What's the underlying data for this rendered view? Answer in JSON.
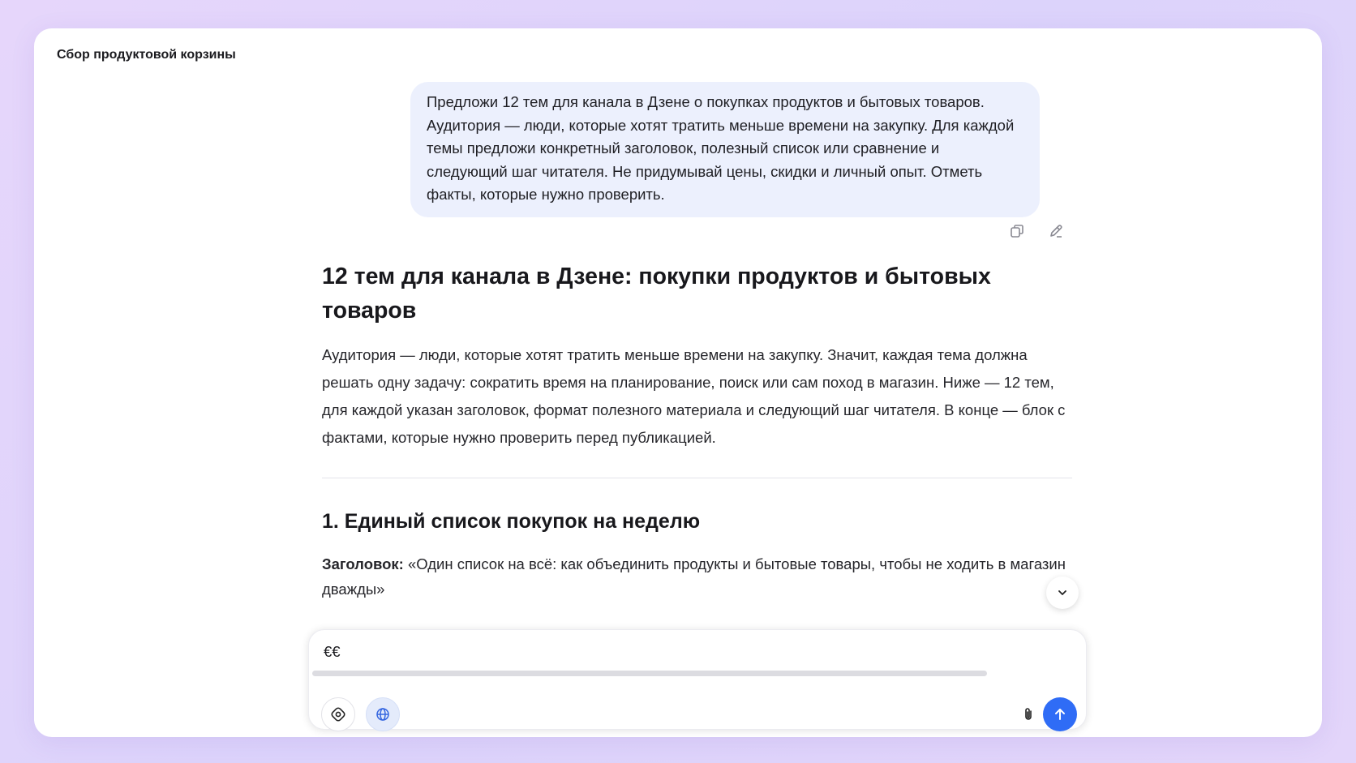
{
  "chat": {
    "title": "Сбор продуктовой корзины"
  },
  "user_message": {
    "text": "Предложи 12 тем для канала в Дзене о покупках продуктов и бытовых товаров. Аудитория — люди, которые хотят тратить меньше времени на закупку. Для каждой темы предложи конкретный заголовок, полезный список или сравнение и следующий шаг читателя. Не придумывай цены, скидки и личный опыт. Отметь факты, которые нужно проверить.",
    "actions": {
      "copy_icon": "copy-icon",
      "edit_icon": "pencil-icon"
    }
  },
  "answer": {
    "heading": "12 тем для канала в Дзене: покупки продуктов и бытовых товаров",
    "intro": "Аудитория — люди, которые хотят тратить меньше времени на закупку. Значит, каждая тема должна решать одну задачу: сократить время на планирование, поиск или сам поход в магазин. Ниже — 12 тем, для каждой указан заголовок, формат полезного материала и следующий шаг читателя. В конце — блок с фактами, которые нужно проверить перед публикацией.",
    "topic1": {
      "title": "1. Единый список покупок на неделю",
      "headline_label": "Заголовок:",
      "headline_text": " «Один список на всё: как объединить продукты и бытовые товары, чтобы не ходить в магазин дважды»"
    }
  },
  "composer": {
    "value": "€€",
    "icons": {
      "tools": "tools-icon",
      "web": "globe-icon",
      "attach": "paperclip-icon",
      "send": "arrow-up-icon"
    },
    "colors": {
      "send_bg": "#2f6cf6",
      "web_active_bg": "#e4ebfb"
    }
  }
}
